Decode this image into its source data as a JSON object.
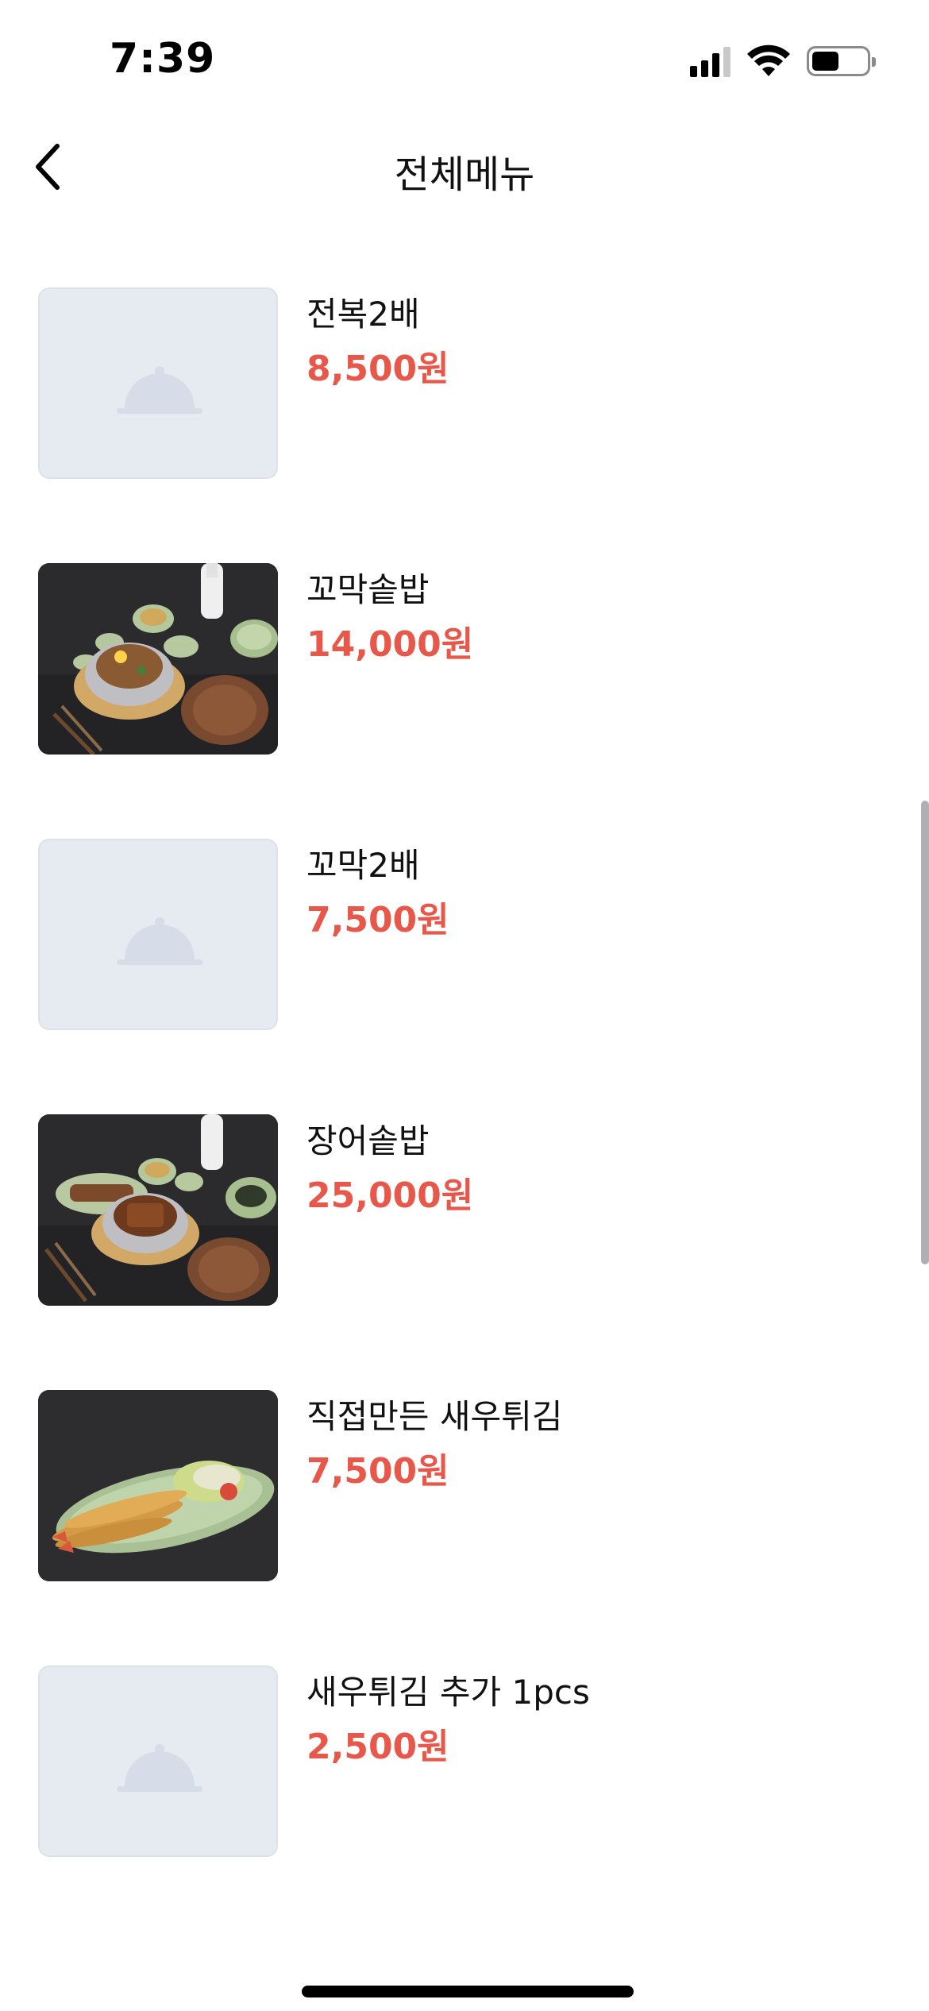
{
  "status_bar": {
    "time": "7:39",
    "icons": [
      "signal-icon",
      "wifi-icon",
      "battery-icon"
    ]
  },
  "nav": {
    "title": "전체메뉴",
    "back_icon": "chevron-left-icon"
  },
  "colors": {
    "price": "#e8584a",
    "placeholder_bg": "#e6eaf1",
    "placeholder_icon": "#d6dde8"
  },
  "menu": [
    {
      "name": "전복2배",
      "price": "8,500원",
      "image": "placeholder"
    },
    {
      "name": "꼬막솥밥",
      "price": "14,000원",
      "image": "photo-kkomak-sotbap"
    },
    {
      "name": "꼬막2배",
      "price": "7,500원",
      "image": "placeholder"
    },
    {
      "name": "장어솥밥",
      "price": "25,000원",
      "image": "photo-jangeo-sotbap"
    },
    {
      "name": "직접만든 새우튀김",
      "price": "7,500원",
      "image": "photo-fried-shrimp"
    },
    {
      "name": "새우튀김 추가 1pcs",
      "price": "2,500원",
      "image": "placeholder"
    }
  ]
}
